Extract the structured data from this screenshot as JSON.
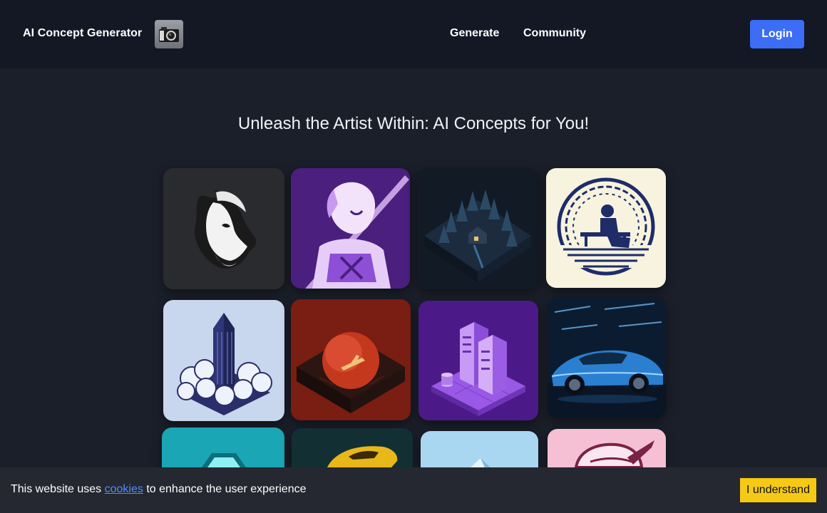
{
  "header": {
    "brand": "AI Concept Generator",
    "logo_icon": "camera-icon",
    "nav": [
      {
        "label": "Generate"
      },
      {
        "label": "Community"
      }
    ],
    "login_label": "Login",
    "colors": {
      "background": "#131824",
      "login": "#3b6df6"
    }
  },
  "main": {
    "title": "Unleash the Artist Within: AI Concepts for You!",
    "gallery": [
      {
        "subject": "goat-head-logo",
        "bg": "#2a2b2e"
      },
      {
        "subject": "anime-swordsman",
        "bg": "#4a1f7d"
      },
      {
        "subject": "isometric-forest-cabin",
        "bg": "#121a26"
      },
      {
        "subject": "person-on-bench-circle-logo",
        "bg": "#f7f3de"
      },
      {
        "subject": "isometric-skyscraper-clouds",
        "bg": "#c8d6ee"
      },
      {
        "subject": "isometric-red-planet-ship",
        "bg": "#7a1d12"
      },
      {
        "subject": "isometric-server-racks",
        "bg": "#4c1a88"
      },
      {
        "subject": "blue-sports-car",
        "bg": "#0c1c30"
      },
      {
        "subject": "teal-hexagon",
        "bg": "#1aa6b5"
      },
      {
        "subject": "yellow-race-car",
        "bg": "#123034"
      },
      {
        "subject": "light-blue-crystal",
        "bg": "#a9d7f2"
      },
      {
        "subject": "pink-rocket-badge",
        "bg": "#f5bfd4"
      }
    ]
  },
  "cookie": {
    "prefix": "This website uses",
    "link": "cookies",
    "suffix": "to enhance the user experience",
    "accept_label": "I understand",
    "colors": {
      "bar": "#252830",
      "link": "#4d8dff",
      "button": "#f6c915"
    }
  }
}
